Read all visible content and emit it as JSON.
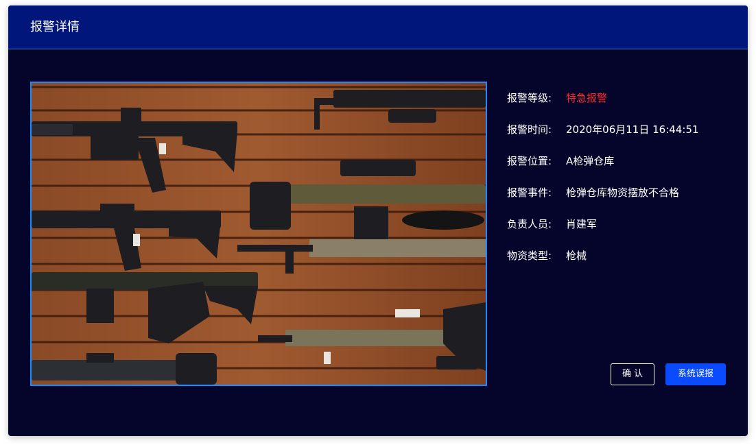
{
  "dialog": {
    "title": "报警详情"
  },
  "alarm_image": {
    "description": "photo of firearms on wooden wall rack"
  },
  "details": [
    {
      "label": "报警等级:",
      "value": "特急报警",
      "value_color": "#ff2a2a"
    },
    {
      "label": "报警时间:",
      "value": "2020年06月11日 16:44:51"
    },
    {
      "label": "报警位置:",
      "value": "A枪弹仓库"
    },
    {
      "label": "报警事件:",
      "value": "枪弹仓库物资摆放不合格"
    },
    {
      "label": "负责人员:",
      "value": "肖建军"
    },
    {
      "label": "物资类型:",
      "value": "枪械"
    }
  ],
  "actions": {
    "confirm_label": "确认",
    "false_alarm_label": "系统误报"
  },
  "colors": {
    "header_bg": "#00167a",
    "body_bg": "#05052b",
    "accent": "#0a4bff",
    "frame_border": "#1a8cff"
  }
}
